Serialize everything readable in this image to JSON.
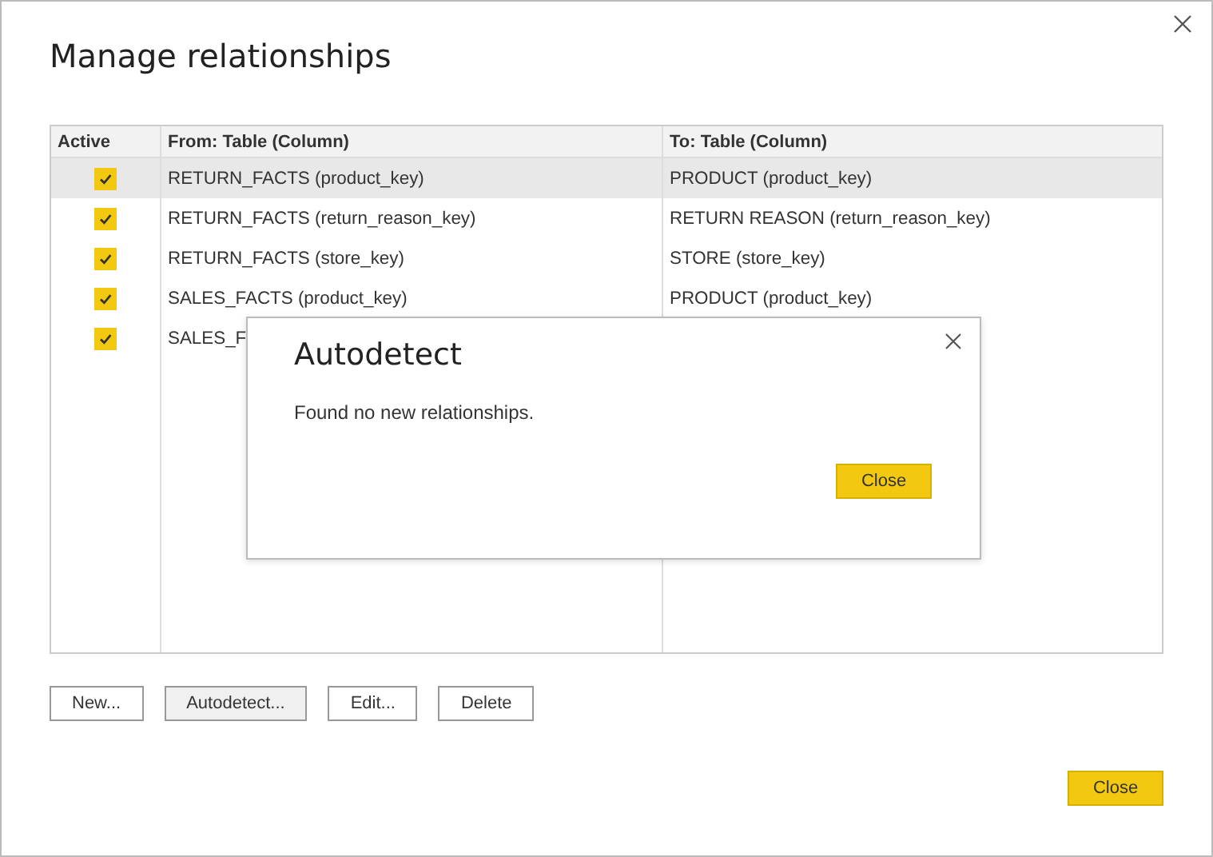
{
  "window": {
    "title": "Manage relationships"
  },
  "table": {
    "columns": [
      "Active",
      "From: Table (Column)",
      "To: Table (Column)"
    ],
    "rows": [
      {
        "active": true,
        "selected": true,
        "from": "RETURN_FACTS (product_key)",
        "to": "PRODUCT (product_key)"
      },
      {
        "active": true,
        "selected": false,
        "from": "RETURN_FACTS (return_reason_key)",
        "to": "RETURN REASON (return_reason_key)"
      },
      {
        "active": true,
        "selected": false,
        "from": "RETURN_FACTS (store_key)",
        "to": "STORE (store_key)"
      },
      {
        "active": true,
        "selected": false,
        "from": "SALES_FACTS (product_key)",
        "to": "PRODUCT (product_key)"
      },
      {
        "active": true,
        "selected": false,
        "from": "SALES_F"
      }
    ]
  },
  "buttons": [
    {
      "label": "New...",
      "selected": false
    },
    {
      "label": "Autodetect...",
      "selected": true
    },
    {
      "label": "Edit...",
      "selected": false
    },
    {
      "label": "Delete",
      "selected": false
    }
  ],
  "close_button": "Close",
  "dialog": {
    "title": "Autodetect",
    "message": "Found no new relationships.",
    "button": "Close"
  }
}
